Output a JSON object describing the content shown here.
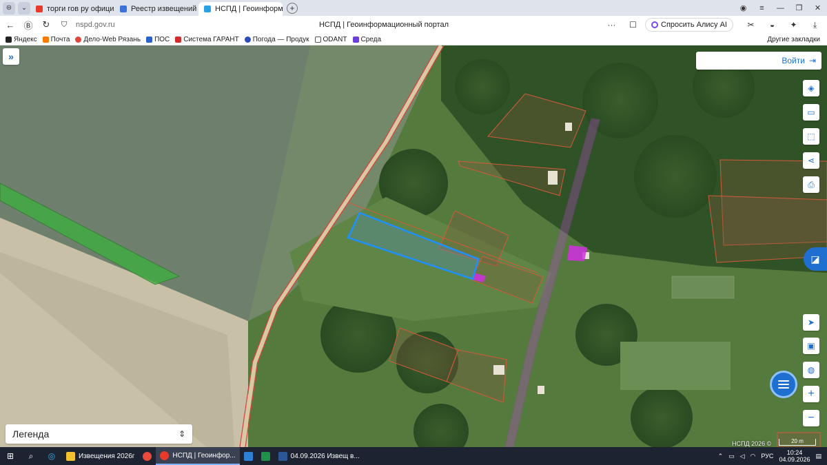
{
  "browser": {
    "tabs": [
      {
        "label": "торги гов ру официальн",
        "favicon_color": "#e8392b",
        "active": false
      },
      {
        "label": "Реестр извещений",
        "favicon_color": "#3b73d8",
        "active": false
      },
      {
        "label": "НСПД | Геоинформаци",
        "favicon_color": "#2aa1e0",
        "active": true
      }
    ],
    "tab_close": "×",
    "new_tab": "+",
    "url": "nspd.gov.ru",
    "page_title": "НСПД | Геоинформационный портал",
    "menu_dots": "···",
    "alice_label": "Спросить Алису AI"
  },
  "bookmarks": {
    "items": [
      {
        "label": "Яндекс",
        "color": "#222222"
      },
      {
        "label": "Почта",
        "color": "#ff7a00"
      },
      {
        "label": "Дело-Web Рязань",
        "color": "#e0463a"
      },
      {
        "label": "ПОС",
        "color": "#2a62c9"
      },
      {
        "label": "Система ГАРАНТ",
        "color": "#d22b2b"
      },
      {
        "label": "Погода — Продук",
        "color": "#2a4bb8"
      },
      {
        "label": "ODANT",
        "color": "#555555"
      },
      {
        "label": "Среда",
        "color": "#6b3fd9"
      }
    ],
    "other": "Другие закладки"
  },
  "map": {
    "login_label": "Войти",
    "legend_label": "Легенда",
    "copyright": "НСПД 2026 ©",
    "scale_label": "20 m",
    "colors": {
      "selected_parcel": "#1e90ff",
      "parcel_outline": "#d35a3a",
      "road_outline": "#b03cc9",
      "highlight": "#d22fe0",
      "accent": "#1f6fd0"
    }
  },
  "taskbar": {
    "apps": [
      {
        "label": "Извещения 2026г",
        "color": "#f2c230",
        "active": false
      },
      {
        "label": "",
        "color": "#e84a3c",
        "active": false
      },
      {
        "label": "НСПД | Геоинфор...",
        "color": "#e8392b",
        "active": true
      },
      {
        "label": "",
        "color": "#2e7fd6",
        "active": false
      },
      {
        "label": "",
        "color": "#1f8f4a",
        "active": false
      },
      {
        "label": "04.09.2026 Извещ в...",
        "color": "#2b5797",
        "active": false
      }
    ],
    "lang": "РУС",
    "time": "10:24",
    "date": "04.09.2026"
  }
}
